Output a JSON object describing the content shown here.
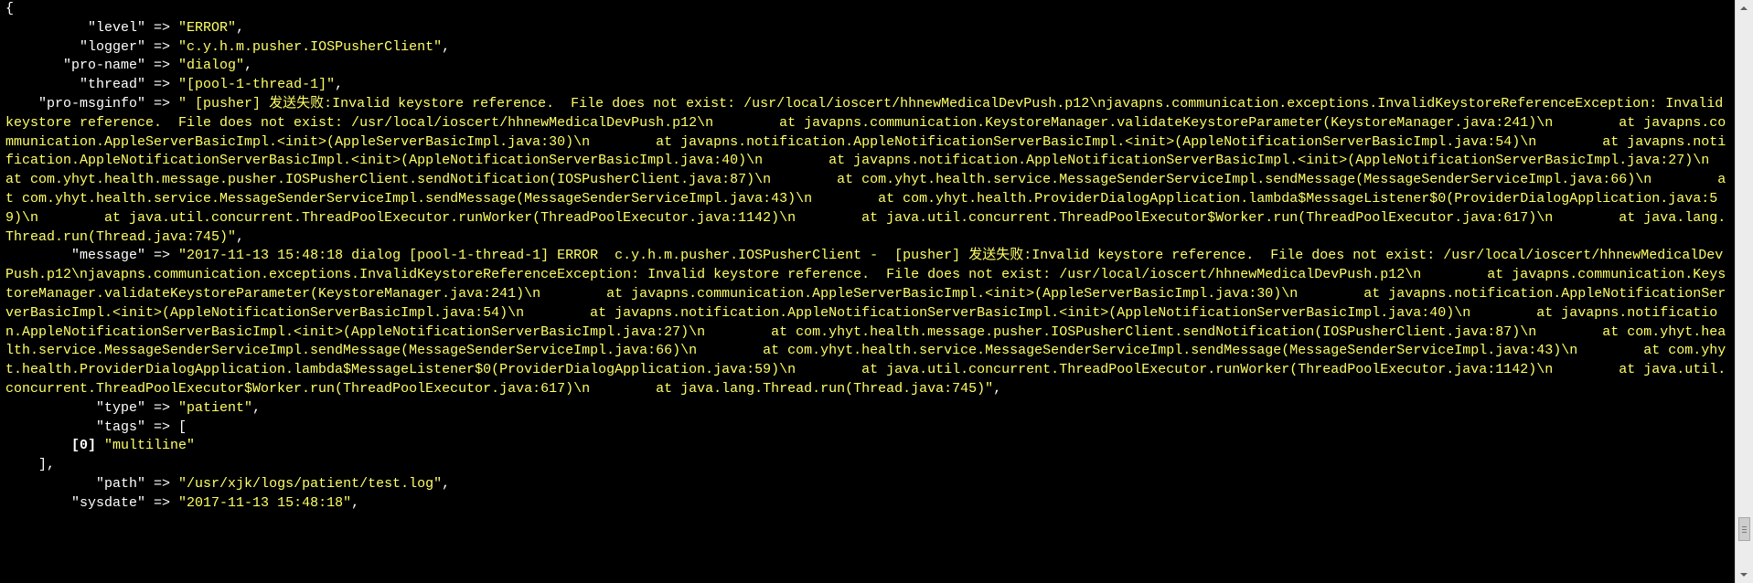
{
  "window": {
    "lines": [
      [
        {
          "t": "{",
          "c": "punc"
        }
      ],
      [
        {
          "t": "          \"level\" => ",
          "c": "key"
        },
        {
          "t": "\"ERROR\"",
          "c": "str"
        },
        {
          "t": ",",
          "c": "punc"
        }
      ],
      [
        {
          "t": "         \"logger\" => ",
          "c": "key"
        },
        {
          "t": "\"c.y.h.m.pusher.IOSPusherClient\"",
          "c": "str"
        },
        {
          "t": ",",
          "c": "punc"
        }
      ],
      [
        {
          "t": "       \"pro-name\" => ",
          "c": "key"
        },
        {
          "t": "\"dialog\"",
          "c": "str"
        },
        {
          "t": ",",
          "c": "punc"
        }
      ],
      [
        {
          "t": "         \"thread\" => ",
          "c": "key"
        },
        {
          "t": "\"[pool-1-thread-1]\"",
          "c": "str"
        },
        {
          "t": ",",
          "c": "punc"
        }
      ],
      [
        {
          "t": "    \"pro-msginfo\" => ",
          "c": "key"
        },
        {
          "t": "\" [pusher] 发送失败:Invalid keystore reference.  File does not exist: /usr/local/ioscert/hhnewMedicalDevPush.p12\\njavapns.communication.exceptions.InvalidKeystoreReferenceException: Invalid keystore reference.  File does not exist: /usr/local/ioscert/hhnewMedicalDevPush.p12\\n        at javapns.communication.KeystoreManager.validateKeystoreParameter(KeystoreManager.java:241)\\n        at javapns.communication.AppleServerBasicImpl.<init>(AppleServerBasicImpl.java:30)\\n        at javapns.notification.AppleNotificationServerBasicImpl.<init>(AppleNotificationServerBasicImpl.java:54)\\n        at javapns.notification.AppleNotificationServerBasicImpl.<init>(AppleNotificationServerBasicImpl.java:40)\\n        at javapns.notification.AppleNotificationServerBasicImpl.<init>(AppleNotificationServerBasicImpl.java:27)\\n        at com.yhyt.health.message.pusher.IOSPusherClient.sendNotification(IOSPusherClient.java:87)\\n        at com.yhyt.health.service.MessageSenderServiceImpl.sendMessage(MessageSenderServiceImpl.java:66)\\n        at com.yhyt.health.service.MessageSenderServiceImpl.sendMessage(MessageSenderServiceImpl.java:43)\\n        at com.yhyt.health.ProviderDialogApplication.lambda$MessageListener$0(ProviderDialogApplication.java:59)\\n        at java.util.concurrent.ThreadPoolExecutor.runWorker(ThreadPoolExecutor.java:1142)\\n        at java.util.concurrent.ThreadPoolExecutor$Worker.run(ThreadPoolExecutor.java:617)\\n        at java.lang.Thread.run(Thread.java:745)\"",
          "c": "str"
        },
        {
          "t": ",",
          "c": "punc"
        }
      ],
      [
        {
          "t": "        \"message\" => ",
          "c": "key"
        },
        {
          "t": "\"2017-11-13 15:48:18 dialog [pool-1-thread-1] ERROR  c.y.h.m.pusher.IOSPusherClient -  [pusher] 发送失败:Invalid keystore reference.  File does not exist: /usr/local/ioscert/hhnewMedicalDevPush.p12\\njavapns.communication.exceptions.InvalidKeystoreReferenceException: Invalid keystore reference.  File does not exist: /usr/local/ioscert/hhnewMedicalDevPush.p12\\n        at javapns.communication.KeystoreManager.validateKeystoreParameter(KeystoreManager.java:241)\\n        at javapns.communication.AppleServerBasicImpl.<init>(AppleServerBasicImpl.java:30)\\n        at javapns.notification.AppleNotificationServerBasicImpl.<init>(AppleNotificationServerBasicImpl.java:54)\\n        at javapns.notification.AppleNotificationServerBasicImpl.<init>(AppleNotificationServerBasicImpl.java:40)\\n        at javapns.notification.AppleNotificationServerBasicImpl.<init>(AppleNotificationServerBasicImpl.java:27)\\n        at com.yhyt.health.message.pusher.IOSPusherClient.sendNotification(IOSPusherClient.java:87)\\n        at com.yhyt.health.service.MessageSenderServiceImpl.sendMessage(MessageSenderServiceImpl.java:66)\\n        at com.yhyt.health.service.MessageSenderServiceImpl.sendMessage(MessageSenderServiceImpl.java:43)\\n        at com.yhyt.health.ProviderDialogApplication.lambda$MessageListener$0(ProviderDialogApplication.java:59)\\n        at java.util.concurrent.ThreadPoolExecutor.runWorker(ThreadPoolExecutor.java:1142)\\n        at java.util.concurrent.ThreadPoolExecutor$Worker.run(ThreadPoolExecutor.java:617)\\n        at java.lang.Thread.run(Thread.java:745)\"",
          "c": "str"
        },
        {
          "t": ",",
          "c": "punc"
        }
      ],
      [
        {
          "t": "           \"type\" => ",
          "c": "key"
        },
        {
          "t": "\"patient\"",
          "c": "str"
        },
        {
          "t": ",",
          "c": "punc"
        }
      ],
      [
        {
          "t": "           \"tags\" => [",
          "c": "key"
        }
      ],
      [
        {
          "t": "        ",
          "c": "key"
        },
        {
          "t": "[0]",
          "c": "idx"
        },
        {
          "t": " ",
          "c": "key"
        },
        {
          "t": "\"multiline\"",
          "c": "str"
        }
      ],
      [
        {
          "t": "    ],",
          "c": "punc"
        }
      ],
      [
        {
          "t": "           \"path\" => ",
          "c": "key"
        },
        {
          "t": "\"/usr/xjk/logs/patient/test.log\"",
          "c": "str"
        },
        {
          "t": ",",
          "c": "punc"
        }
      ],
      [
        {
          "t": "        \"sysdate\" => ",
          "c": "key"
        },
        {
          "t": "\"2017-11-13 15:48:18\"",
          "c": "str"
        },
        {
          "t": ",",
          "c": "punc"
        }
      ]
    ],
    "colors": {
      "background": "#000000",
      "text": "#ffffff",
      "string": "#ffff66"
    }
  }
}
